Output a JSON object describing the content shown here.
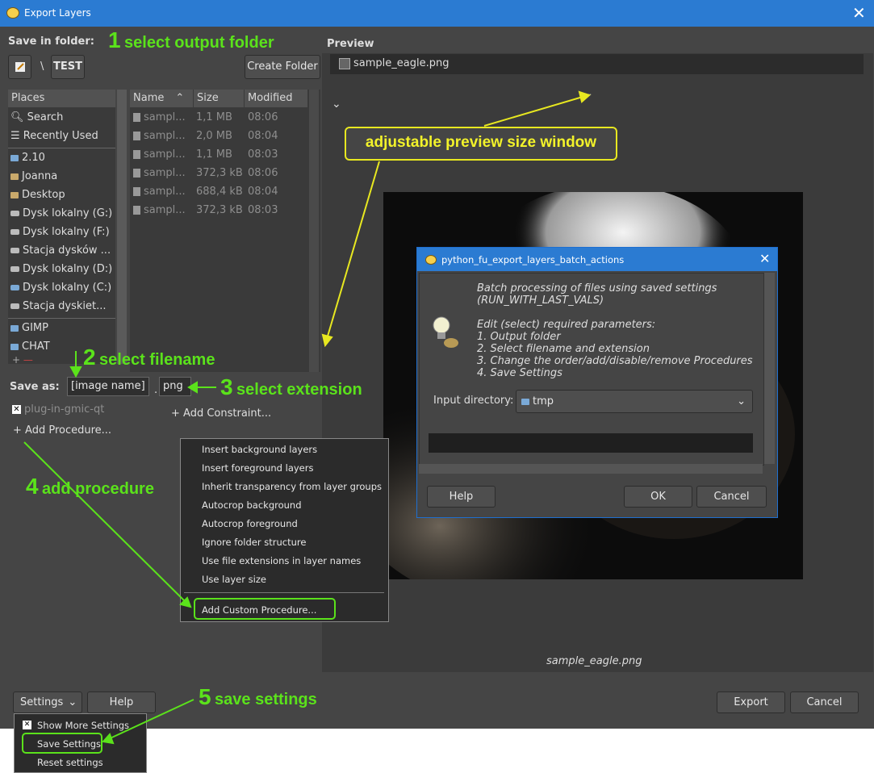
{
  "window": {
    "title": "Export Layers",
    "close": "✕"
  },
  "left": {
    "save_in_label": "Save in folder:",
    "path_sep": "\\",
    "path_button": "TEST",
    "create_folder": "Create Folder",
    "places_header": "Places",
    "places": [
      "Search",
      "Recently Used",
      "2.10",
      "Joanna",
      "Desktop",
      "Dysk lokalny (G:)",
      "Dysk lokalny (F:)",
      "Stacja dysków ...",
      "Dysk lokalny (D:)",
      "Dysk lokalny (C:)",
      "Stacja dyskiet...",
      "GIMP",
      "CHAT"
    ],
    "files_columns": [
      "Name",
      "Size",
      "Modified"
    ],
    "files": [
      {
        "name": "sampl...",
        "size": "1,1 MB",
        "modified": "08:06"
      },
      {
        "name": "sampl...",
        "size": "2,0 MB",
        "modified": "08:04"
      },
      {
        "name": "sampl...",
        "size": "1,1 MB",
        "modified": "08:03"
      },
      {
        "name": "sampl...",
        "size": "372,3 kB",
        "modified": "08:06"
      },
      {
        "name": "sampl...",
        "size": "688,4 kB",
        "modified": "08:04"
      },
      {
        "name": "sampl...",
        "size": "372,3 kB",
        "modified": "08:03"
      }
    ],
    "save_as_label": "Save as:",
    "filename_value": "[image name]",
    "dot": ".",
    "extension_value": "png",
    "procedure_item": "plug-in-gmic-qt",
    "add_procedure": "Add Procedure...",
    "add_constraint": "Add Constraint..."
  },
  "preview": {
    "label": "Preview",
    "file": "sample_eagle.png",
    "caption": "sample_eagle.png"
  },
  "procedure_menu": {
    "items": [
      "Insert background layers",
      "Insert foreground layers",
      "Inherit transparency from layer groups",
      "Autocrop background",
      "Autocrop foreground",
      "Ignore folder structure",
      "Use file extensions in layer names",
      "Use layer size"
    ],
    "custom": "Add Custom Procedure..."
  },
  "dialog": {
    "title": "python_fu_export_layers_batch_actions",
    "line1": "Batch processing of files using saved settings",
    "line2": "(RUN_WITH_LAST_VALS)",
    "line3": "Edit (select) required parameters:",
    "line4": "1. Output folder",
    "line5": "2. Select filename and extension",
    "line6": "3. Change the order/add/disable/remove Procedures",
    "line7": "4. Save Settings",
    "input_label": "Input directory:",
    "input_value": "tmp",
    "help": "Help",
    "ok": "OK",
    "cancel": "Cancel"
  },
  "footer": {
    "settings": "Settings",
    "help": "Help",
    "export": "Export",
    "cancel": "Cancel",
    "settings_menu": [
      "Show More Settings",
      "Save Settings",
      "Reset settings"
    ]
  },
  "annotations": {
    "n1": "1",
    "t1": "select output folder",
    "n2": "2",
    "t2": "select filename",
    "n3": "3",
    "t3": "select extension",
    "n4": "4",
    "t4": "add procedure",
    "n5": "5",
    "t5": "save settings",
    "preview_note": "adjustable preview size window"
  },
  "colors": {
    "accent": "#5be21b",
    "callout": "#ffff33",
    "titlebar": "#2b7bd2"
  }
}
